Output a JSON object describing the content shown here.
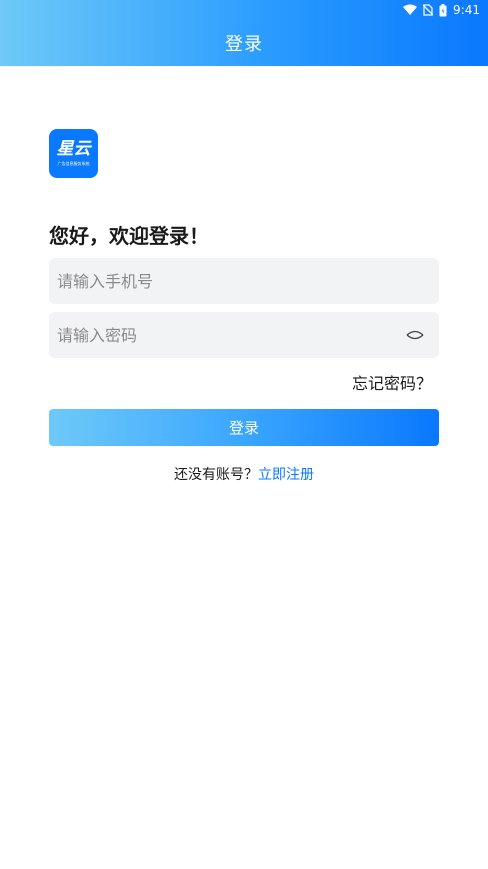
{
  "status_bar": {
    "time": "9:41"
  },
  "header": {
    "title": "登录"
  },
  "logo": {
    "main_text": "星云",
    "sub_text": "广告信息服务系统"
  },
  "greeting": "您好，欢迎登录！",
  "form": {
    "phone_placeholder": "请输入手机号",
    "password_placeholder": "请输入密码",
    "forgot_label": "忘记密码？",
    "login_label": "登录"
  },
  "register": {
    "prompt": "还没有账号？",
    "link_label": "立即注册"
  },
  "colors": {
    "accent": "#0a78ff",
    "gradient_start": "#6ec9f7",
    "field_bg": "#f2f3f5"
  }
}
